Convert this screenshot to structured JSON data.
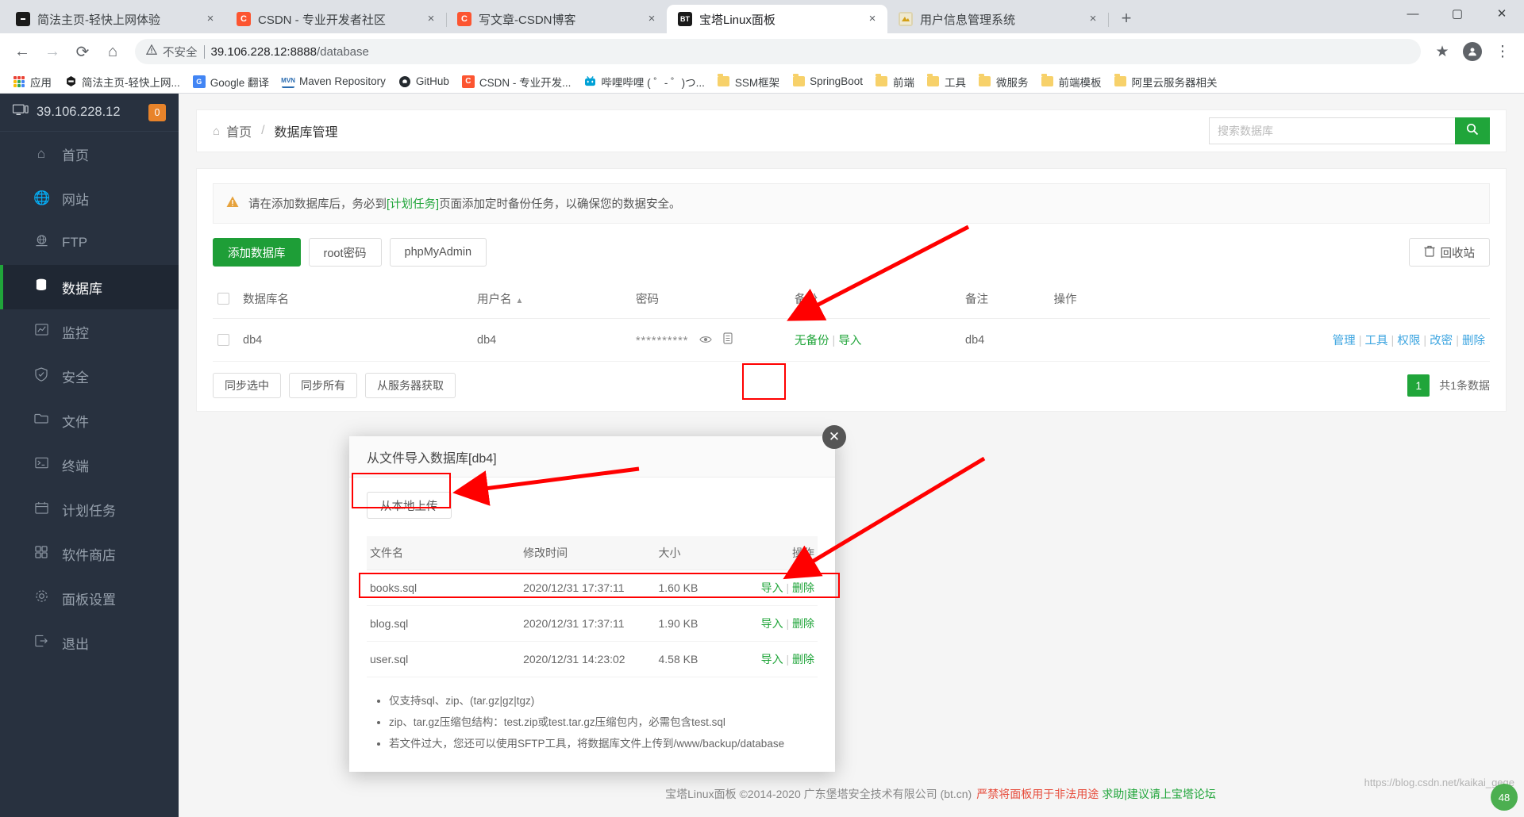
{
  "browser": {
    "tabs": [
      {
        "title": "简法主页-轻快上网体验",
        "favicon": "hexagon-icon",
        "favicon_color": "#1a1a1a",
        "favicon_text": "",
        "active": false
      },
      {
        "title": "CSDN - 专业开发者社区",
        "favicon": "csdn-icon",
        "favicon_color": "#fc5531",
        "favicon_text": "C",
        "active": false
      },
      {
        "title": "写文章-CSDN博客",
        "favicon": "csdn-icon",
        "favicon_color": "#fc5531",
        "favicon_text": "C",
        "active": false
      },
      {
        "title": "宝塔Linux面板",
        "favicon": "bt-icon",
        "favicon_color": "#1a1a1a",
        "favicon_text": "BT",
        "active": true
      },
      {
        "title": "用户信息管理系统",
        "favicon": "app-icon",
        "favicon_color": "#e8e0c0",
        "favicon_text": "",
        "active": false
      }
    ],
    "new_tab_label": "+",
    "tab_close_label": "×",
    "window_controls": {
      "minimize": "—",
      "maximize": "▢",
      "close": "✕"
    },
    "nav": {
      "back": "←",
      "forward": "→",
      "reload": "⟳",
      "home": "⌂"
    },
    "omnibox": {
      "warning_icon": "warning-triangle-icon",
      "warning_label": "不安全",
      "url_host": "39.106.228.12:8888",
      "url_path": "/database",
      "star_icon": "★",
      "profile_icon": "person-icon",
      "menu_icon": "⋮"
    },
    "bookmarks": [
      {
        "label": "应用",
        "icon": "apps-grid-icon"
      },
      {
        "label": "简法主页-轻快上网...",
        "icon": "hexagon-icon"
      },
      {
        "label": "Google 翻译",
        "icon": "translate-icon"
      },
      {
        "label": "Maven Repository",
        "icon": "maven-icon"
      },
      {
        "label": "GitHub",
        "icon": "github-icon"
      },
      {
        "label": "CSDN - 专业开发...",
        "icon": "csdn-icon"
      },
      {
        "label": "哔哩哔哩 ( ゜- ゜)つ...",
        "icon": "bilibili-icon"
      },
      {
        "label": "SSM框架",
        "icon": "folder-icon"
      },
      {
        "label": "SpringBoot",
        "icon": "folder-icon"
      },
      {
        "label": "前端",
        "icon": "folder-icon"
      },
      {
        "label": "工具",
        "icon": "folder-icon"
      },
      {
        "label": "微服务",
        "icon": "folder-icon"
      },
      {
        "label": "前端模板",
        "icon": "folder-icon"
      },
      {
        "label": "阿里云服务器相关",
        "icon": "folder-icon"
      }
    ]
  },
  "sidebar": {
    "host": "39.106.228.12",
    "host_icon": "monitor-icon",
    "badge": "0",
    "items": [
      {
        "label": "首页",
        "icon": "home-icon",
        "active": false
      },
      {
        "label": "网站",
        "icon": "globe-icon",
        "active": false
      },
      {
        "label": "FTP",
        "icon": "ftp-icon",
        "active": false
      },
      {
        "label": "数据库",
        "icon": "database-icon",
        "active": true
      },
      {
        "label": "监控",
        "icon": "chart-icon",
        "active": false
      },
      {
        "label": "安全",
        "icon": "shield-icon",
        "active": false
      },
      {
        "label": "文件",
        "icon": "folder-icon",
        "active": false
      },
      {
        "label": "终端",
        "icon": "terminal-icon",
        "active": false
      },
      {
        "label": "计划任务",
        "icon": "calendar-icon",
        "active": false
      },
      {
        "label": "软件商店",
        "icon": "apps-icon",
        "active": false
      },
      {
        "label": "面板设置",
        "icon": "settings-icon",
        "active": false
      },
      {
        "label": "退出",
        "icon": "logout-icon",
        "active": false
      }
    ]
  },
  "breadcrumb": {
    "home_icon": "home-icon",
    "home": "首页",
    "separator": "/",
    "current": "数据库管理"
  },
  "search": {
    "placeholder": "搜索数据库",
    "value": "",
    "icon": "search-icon"
  },
  "notice": {
    "icon": "warning-triangle-icon",
    "text_before": "请在添加数据库后，务必到",
    "link": "[计划任务]",
    "text_after": "页面添加定时备份任务，以确保您的数据安全。"
  },
  "toolbar": {
    "add_db": "添加数据库",
    "root_password": "root密码",
    "phpmyadmin": "phpMyAdmin",
    "recycle_bin": "回收站",
    "recycle_icon": "trash-icon"
  },
  "db_table": {
    "headers": [
      "数据库名",
      "用户名",
      "密码",
      "备份",
      "备注",
      "操作"
    ],
    "sort_column": "用户名",
    "sort_icon": "▲",
    "rows": [
      {
        "name": "db4",
        "user": "db4",
        "password_mask": "**********",
        "eye_icon": "eye-icon",
        "copy_icon": "copy-icon",
        "backup_status": "无备份",
        "backup_import": "导入",
        "note": "db4",
        "ops": [
          "管理",
          "工具",
          "权限",
          "改密",
          "删除"
        ]
      }
    ]
  },
  "table_footer": {
    "sync_selected": "同步选中",
    "sync_all": "同步所有",
    "fetch_from_server": "从服务器获取",
    "page_number": "1",
    "total": "共1条数据"
  },
  "modal": {
    "title": "从文件导入数据库[db4]",
    "close_icon": "✕",
    "upload_button": "从本地上传",
    "file_headers": [
      "文件名",
      "修改时间",
      "大小",
      "操作"
    ],
    "files": [
      {
        "name": "books.sql",
        "mtime": "2020/12/31 17:37:11",
        "size": "1.60 KB",
        "import": "导入",
        "delete": "删除",
        "highlighted": false
      },
      {
        "name": "blog.sql",
        "mtime": "2020/12/31 17:37:11",
        "size": "1.90 KB",
        "import": "导入",
        "delete": "删除",
        "highlighted": true
      },
      {
        "name": "user.sql",
        "mtime": "2020/12/31 14:23:02",
        "size": "4.58 KB",
        "import": "导入",
        "delete": "删除",
        "highlighted": false
      }
    ],
    "notes": [
      "仅支持sql、zip、(tar.gz|gz|tgz)",
      "zip、tar.gz压缩包结构：test.zip或test.tar.gz压缩包内，必需包含test.sql",
      "若文件过大，您还可以使用SFTP工具，将数据库文件上传到/www/backup/database"
    ]
  },
  "footer": {
    "text": "宝塔Linux面板 ©2014-2020 广东堡塔安全技术有限公司 (bt.cn)",
    "warning": "严禁将面板用于非法用途",
    "help": "求助|建议请上宝塔论坛"
  },
  "watermark": "https://blog.csdn.net/kaikai_gege",
  "float_button": "48"
}
